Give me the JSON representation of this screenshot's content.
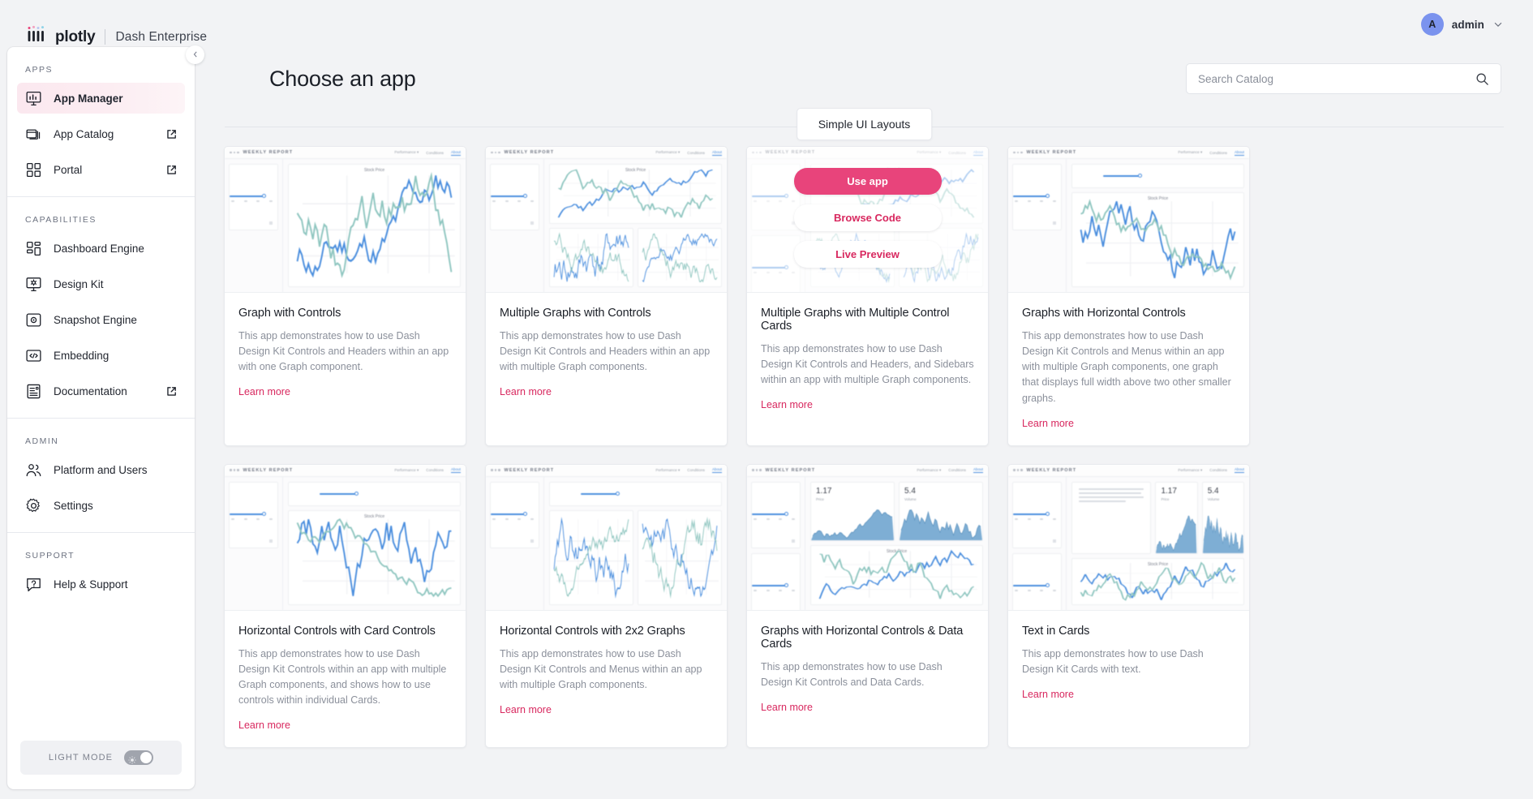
{
  "brand": {
    "word": "plotly",
    "product": "Dash Enterprise",
    "logo_icon": "plotly-logo-icon"
  },
  "topbar": {
    "avatar_initial": "A",
    "user_name": "admin",
    "chevron_icon": "chevron-down-icon"
  },
  "sidebar": {
    "collapse_icon": "chevron-left-icon",
    "sections": [
      {
        "title": "APPS",
        "items": [
          {
            "label": "App Manager",
            "icon": "monitor-chart-icon",
            "active": true,
            "external": false
          },
          {
            "label": "App Catalog",
            "icon": "stacked-windows-icon",
            "active": false,
            "external": true
          },
          {
            "label": "Portal",
            "icon": "grid-squares-icon",
            "active": false,
            "external": true
          }
        ]
      },
      {
        "title": "CAPABILITIES",
        "items": [
          {
            "label": "Dashboard Engine",
            "icon": "dashboard-grid-icon",
            "active": false,
            "external": false
          },
          {
            "label": "Design Kit",
            "icon": "monitor-gear-icon",
            "active": false,
            "external": false
          },
          {
            "label": "Snapshot Engine",
            "icon": "camera-icon",
            "active": false,
            "external": false
          },
          {
            "label": "Embedding",
            "icon": "code-brackets-icon",
            "active": false,
            "external": false
          },
          {
            "label": "Documentation",
            "icon": "document-lines-icon",
            "active": false,
            "external": true
          }
        ]
      },
      {
        "title": "ADMIN",
        "items": [
          {
            "label": "Platform and Users",
            "icon": "users-icon",
            "active": false,
            "external": false
          },
          {
            "label": "Settings",
            "icon": "gear-icon",
            "active": false,
            "external": false
          }
        ]
      },
      {
        "title": "SUPPORT",
        "items": [
          {
            "label": "Help & Support",
            "icon": "question-bubble-icon",
            "active": false,
            "external": false
          }
        ]
      }
    ],
    "theme_toggle": {
      "label": "LIGHT MODE",
      "icon": "sun-icon",
      "state": "on"
    }
  },
  "main": {
    "page_title": "Choose an app",
    "search": {
      "placeholder": "Search Catalog",
      "value": "",
      "icon": "search-icon"
    },
    "section_pill": "Simple UI Layouts"
  },
  "overlay": {
    "use_app": "Use app",
    "browse_code": "Browse Code",
    "live_preview": "Live Preview"
  },
  "thumbnail": {
    "report_title": "WEEKLY REPORT",
    "menus": [
      "Performance",
      "Conditions",
      "About"
    ],
    "chart_title": "Stock Price",
    "data_cards": [
      {
        "value": "1.17",
        "label": "Price"
      },
      {
        "value": "5.4",
        "label": "Volume"
      }
    ]
  },
  "cards": [
    {
      "title": "Graph with Controls",
      "desc": "This app demonstrates how to use Dash Design Kit Controls and Headers within an app with one Graph component.",
      "learn_more": "Learn more",
      "layout": "one-graph",
      "hovered": false
    },
    {
      "title": "Multiple Graphs with Controls",
      "desc": "This app demonstrates how to use Dash Design Kit Controls and Headers within an app with multiple Graph components.",
      "learn_more": "Learn more",
      "layout": "multi-graph",
      "hovered": false
    },
    {
      "title": "Multiple Graphs with Multiple Control Cards",
      "desc": "This app demonstrates how to use Dash Design Kit Controls and Headers, and Sidebars within an app with multiple Graph components.",
      "learn_more": "Learn more",
      "layout": "multi-control",
      "hovered": true
    },
    {
      "title": "Graphs with Horizontal Controls",
      "desc": "This app demonstrates how to use Dash Design Kit Controls and Menus within an app with multiple Graph components, one graph that displays full width above two other smaller graphs.",
      "learn_more": "Learn more",
      "layout": "horizontal-controls",
      "hovered": false
    },
    {
      "title": "Horizontal Controls with Card Controls",
      "desc": "This app demonstrates how to use Dash Design Kit Controls within an app with multiple Graph components, and shows how to use controls within individual Cards.",
      "learn_more": "Learn more",
      "layout": "card-controls",
      "hovered": false
    },
    {
      "title": "Horizontal Controls with 2x2 Graphs",
      "desc": "This app demonstrates how to use Dash Design Kit Controls and Menus within an app with multiple Graph components.",
      "learn_more": "Learn more",
      "layout": "grid-2x2",
      "hovered": false
    },
    {
      "title": "Graphs with Horizontal Controls & Data Cards",
      "desc": "This app demonstrates how to use Dash Design Kit Controls and Data Cards.",
      "learn_more": "Learn more",
      "layout": "data-cards",
      "hovered": false
    },
    {
      "title": "Text in Cards",
      "desc": "This app demonstrates how to use Dash Design Kit Cards with text.",
      "learn_more": "Learn more",
      "layout": "text-cards",
      "hovered": false
    }
  ],
  "colors": {
    "accent_pink": "#d8285f",
    "button_pink": "#e8447b",
    "active_nav_bg": "#fbe8ef",
    "page_bg": "#f2f3f5",
    "chart_blue": "#4a8ede",
    "chart_teal": "#8fc6c0",
    "area_fill": "#7eaed4",
    "avatar_bg": "#7b93ee"
  }
}
